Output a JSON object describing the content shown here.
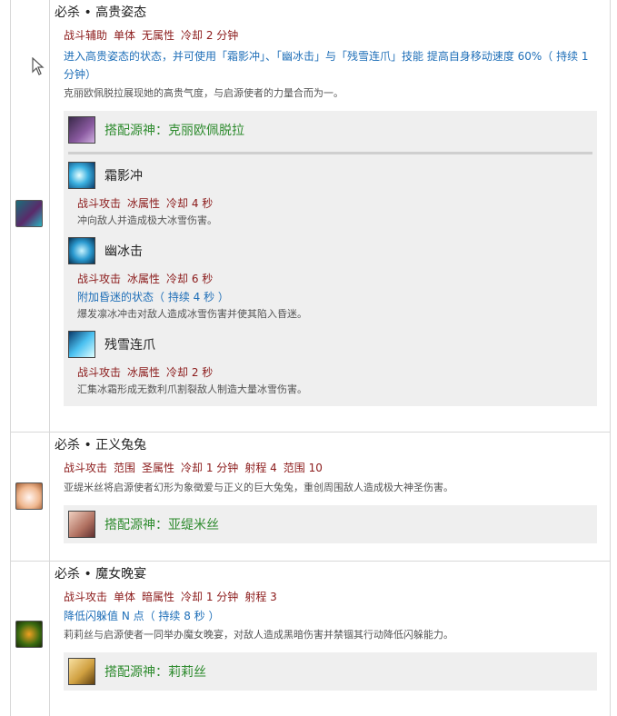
{
  "rows": [
    {
      "title": "必杀 • 高贵姿态",
      "tags": [
        "战斗辅助",
        "单体",
        "无属性",
        "冷却 2 分钟"
      ],
      "effect": "进入高贵姿态的状态，并可使用「霜影冲」、「幽冰击」与「残雪连爪」技能 提高自身移动速度 60%（ 持续 1 分钟）",
      "desc": "克丽欧佩脱拉展现她的高贵气度，与启源使者的力量合而为一。",
      "partner": "搭配源神：克丽欧佩脱拉",
      "skills": [
        {
          "name": "霜影冲",
          "tags": [
            "战斗攻击",
            "冰属性",
            "冷却 4 秒"
          ],
          "effect": "",
          "desc": "冲向敌人并造成极大冰雪伤害。"
        },
        {
          "name": "幽冰击",
          "tags": [
            "战斗攻击",
            "冰属性",
            "冷却 6 秒"
          ],
          "effect": "附加昏迷的状态（ 持续 4 秒 ）",
          "desc": "爆发凛冰冲击对敌人造成冰雪伤害并使其陷入昏迷。"
        },
        {
          "name": "残雪连爪",
          "tags": [
            "战斗攻击",
            "冰属性",
            "冷却 2 秒"
          ],
          "effect": "",
          "desc": "汇集冰霜形成无数利爪割裂敌人制造大量冰雪伤害。"
        }
      ]
    },
    {
      "title": "必杀 • 正义兔兔",
      "tags": [
        "战斗攻击",
        "范围",
        "圣属性",
        "冷却 1 分钟",
        "射程 4",
        "范围 10"
      ],
      "effect": "",
      "desc": "亚缇米丝将启源使者幻形为象徵爱与正义的巨大兔兔，重创周围敌人造成极大神圣伤害。",
      "partner": "搭配源神：亚缇米丝"
    },
    {
      "title": "必杀 • 魔女晚宴",
      "tags": [
        "战斗攻击",
        "单体",
        "暗属性",
        "冷却 1 分钟",
        "射程 3"
      ],
      "effect": "降低闪躲值 N 点（ 持续 8 秒 ）",
      "desc": "莉莉丝与启源使者一同举办魔女晚宴，对敌人造成黑暗伤害并禁锢其行动降低闪躲能力。",
      "partner": "搭配源神：莉莉丝"
    }
  ],
  "colors": {
    "tag": "#8b1a1a",
    "effect": "#1f6fb8",
    "partner": "#2e8b2e"
  }
}
